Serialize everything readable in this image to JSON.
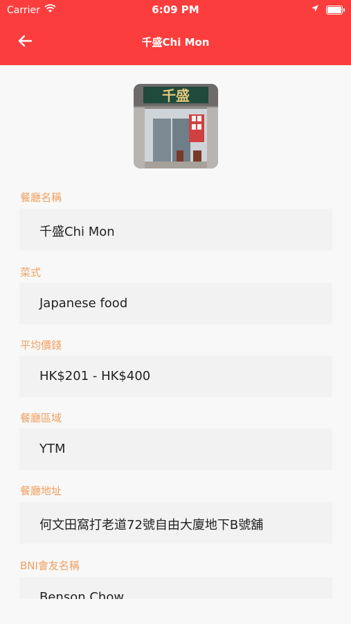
{
  "status_bar": {
    "carrier": "Carrier",
    "time": "6:09 PM"
  },
  "nav": {
    "title": "千盛Chi Mon",
    "back_icon": "arrow-left-icon"
  },
  "colors": {
    "header": "#fc3d3d",
    "label": "#f0a060",
    "field_bg": "#f2f2f2"
  },
  "fields": [
    {
      "label": "餐廳名稱",
      "value": "千盛Chi Mon"
    },
    {
      "label": "菜式",
      "value": "Japanese food"
    },
    {
      "label": "平均價錢",
      "value": "HK$201 - HK$400"
    },
    {
      "label": "餐廳區域",
      "value": "YTM"
    },
    {
      "label": "餐廳地址",
      "value": "何文田窩打老道72號自由大廈地下B號舖"
    },
    {
      "label": "BNI會友名稱",
      "value": "Benson Chow"
    }
  ],
  "restaurant_photo": {
    "sign_text": "千盛"
  }
}
